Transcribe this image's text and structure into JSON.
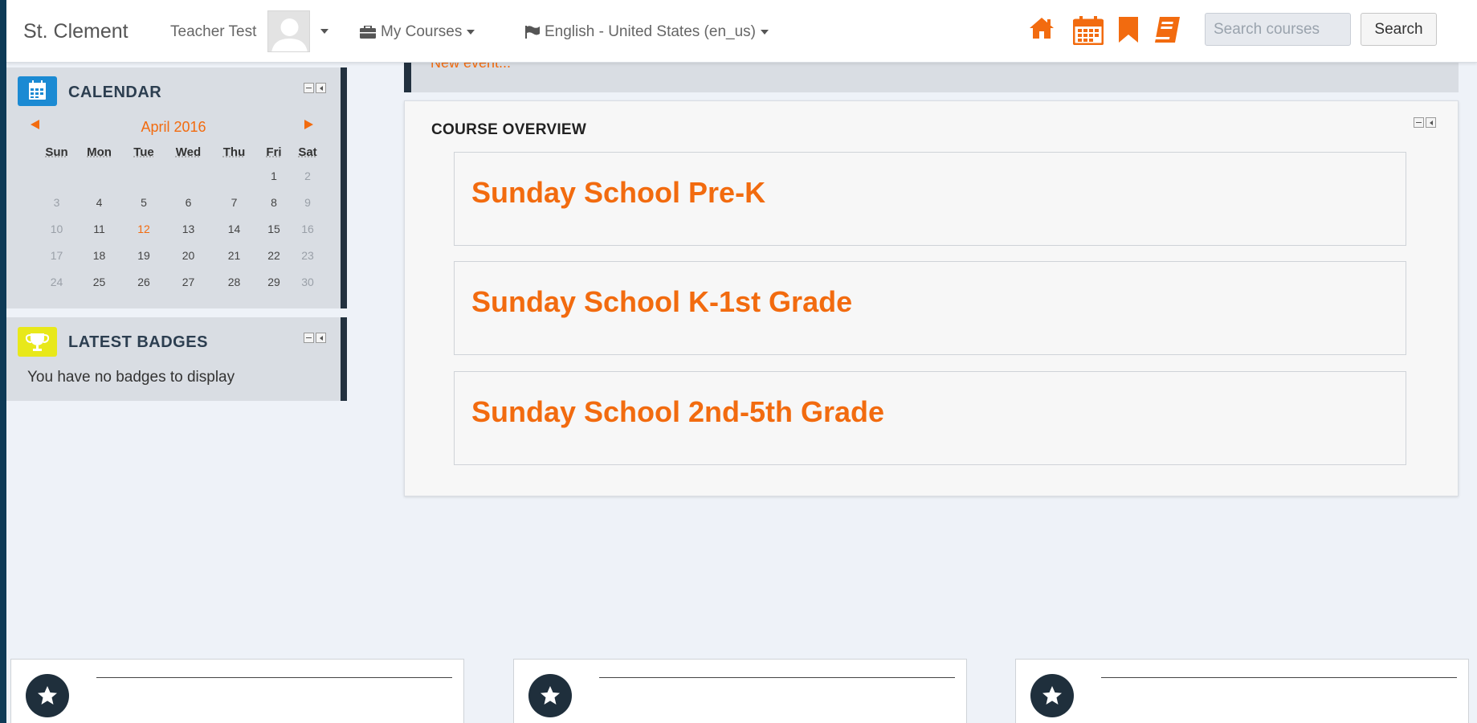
{
  "navbar": {
    "brand": "St. Clement",
    "user_name": "Teacher Test",
    "my_courses": "My Courses",
    "language": "English - United States (en_us)",
    "search_placeholder": "Search courses",
    "search_button": "Search",
    "icons": [
      "home-icon",
      "calendar-icon",
      "bookmark-icon",
      "book-icon"
    ],
    "accent_color": "#f26b0f"
  },
  "calendar_block": {
    "title": "CALENDAR",
    "month": "April 2016",
    "weekdays": [
      "Sun",
      "Mon",
      "Tue",
      "Wed",
      "Thu",
      "Fri",
      "Sat"
    ],
    "weeks": [
      [
        "",
        "",
        "",
        "",
        "",
        "1",
        "2"
      ],
      [
        "3",
        "4",
        "5",
        "6",
        "7",
        "8",
        "9"
      ],
      [
        "10",
        "11",
        "12",
        "13",
        "14",
        "15",
        "16"
      ],
      [
        "17",
        "18",
        "19",
        "20",
        "21",
        "22",
        "23"
      ],
      [
        "24",
        "25",
        "26",
        "27",
        "28",
        "29",
        "30"
      ]
    ],
    "today": "12",
    "icon_color": "#1b8ad3"
  },
  "badges_block": {
    "title": "LATEST BADGES",
    "empty_text": "You have no badges to display",
    "icon_color": "#e8e81a"
  },
  "events_strip": {
    "link_text": "New event..."
  },
  "course_overview": {
    "title": "COURSE OVERVIEW",
    "courses": [
      "Sunday School Pre-K",
      "Sunday School K-1st Grade",
      "Sunday School 2nd-5th Grade"
    ]
  },
  "footer": {
    "cards": [
      {
        "icon": "star-icon"
      },
      {
        "icon": "star-icon"
      },
      {
        "icon": "star-icon"
      }
    ]
  }
}
